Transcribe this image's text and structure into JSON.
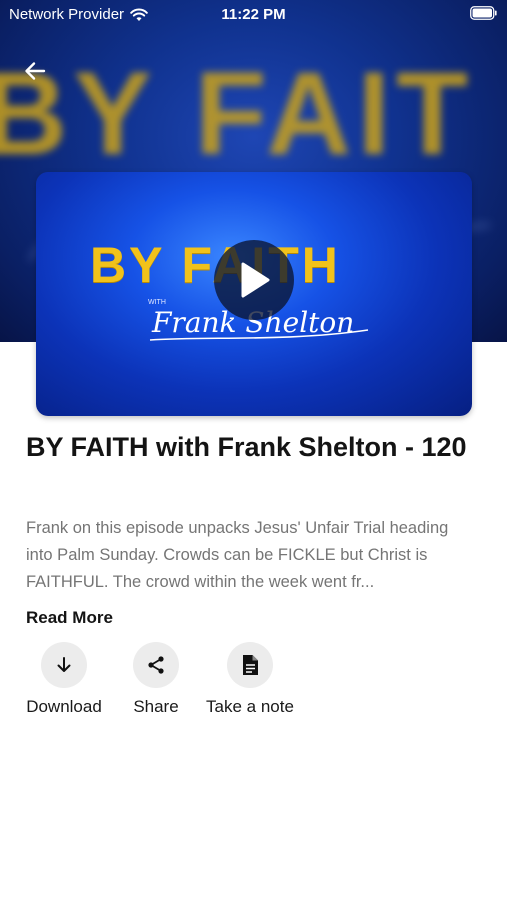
{
  "status_bar": {
    "carrier": "Network Provider",
    "time": "11:22 PM",
    "icons": [
      "wifi-icon",
      "battery-icon"
    ]
  },
  "hero": {
    "background_text": "BY FAIT",
    "back_icon": "arrow-left-icon"
  },
  "video": {
    "art_title": "BY FAITH",
    "art_with": "WITH",
    "art_signature": "Frank Shelton",
    "play_icon": "play-icon"
  },
  "episode": {
    "title": "BY FAITH with Frank Shelton - 120",
    "description": "Frank on this episode unpacks Jesus' Unfair Trial heading into Palm Sunday. Crowds can be FICKLE but Christ is FAITHFUL. The crowd within the week went fr...",
    "read_more_label": "Read More"
  },
  "actions": [
    {
      "label": "Download",
      "icon": "download-icon"
    },
    {
      "label": "Share",
      "icon": "share-icon"
    },
    {
      "label": "Take a note",
      "icon": "note-icon"
    }
  ],
  "colors": {
    "hero_blue": "#10328f",
    "title_gold": "#f1c21b",
    "action_circle": "#ececec",
    "description_gray": "#757575"
  }
}
